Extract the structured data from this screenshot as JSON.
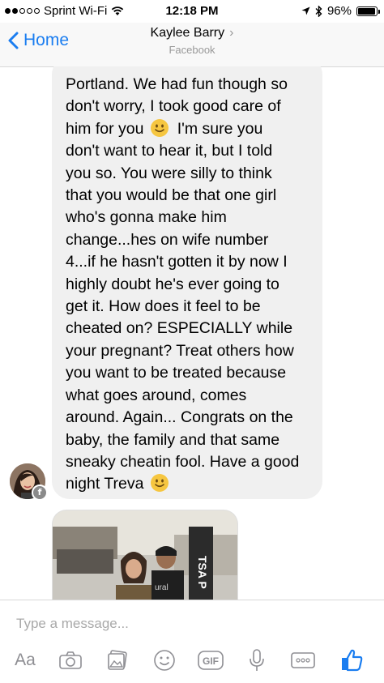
{
  "status_bar": {
    "carrier": "Sprint Wi-Fi",
    "time": "12:18 PM",
    "battery": "96%",
    "battery_level": 0.96
  },
  "nav": {
    "back_label": "Home",
    "contact_name": "Kaylee Barry",
    "contact_source": "Facebook"
  },
  "message": {
    "lines": [
      "Portland. We had fun though so",
      "don't worry, I took good care of",
      "him for you",
      "I'm sure you",
      "don't want to hear it, but I told",
      "you so. You were silly to think",
      "that you would be that one girl",
      "who's gonna make him",
      "change...hes on wife number",
      "4...if he hasn't gotten it by now I",
      "highly doubt he's ever going to",
      "get it. How does it feel to be",
      "cheated on? ESPECIALLY while",
      "your pregnant? Treat others how",
      "you want to be treated because",
      "what goes around, comes",
      "around. Again... Congrats on the",
      "baby, the family and that same",
      "sneaky cheatin fool. Have a good",
      "night Treva"
    ],
    "avatar_badge": "f"
  },
  "photo": {
    "sign_text": "TSA P",
    "shirt_text": "ural"
  },
  "composer": {
    "placeholder": "Type a message...",
    "text_format_label": "Aa",
    "gif_label": "GIF"
  },
  "colors": {
    "accent": "#1a7df0",
    "bubble": "#f0f0f0",
    "icon_gray": "#8e8e93"
  }
}
